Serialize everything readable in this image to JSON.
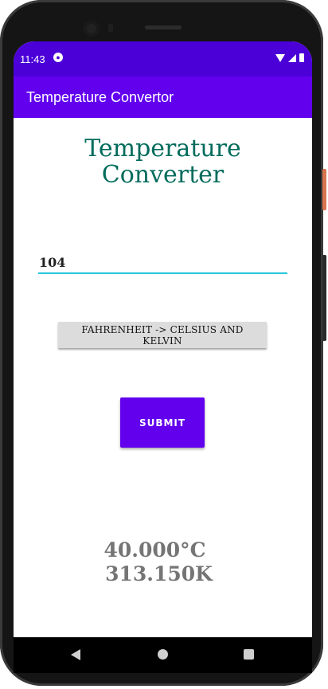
{
  "status_bar": {
    "time": "11:43",
    "app_icon": "notification-app-icon"
  },
  "app_bar": {
    "title": "Temperature Convertor"
  },
  "main": {
    "heading_line1": "Temperature",
    "heading_line2": "Converter",
    "input_value": "104",
    "mode_button_label": "FAHRENHEIT -> CELSIUS AND KELVIN",
    "submit_label": "SUBMIT",
    "result_celsius": "40.000°C",
    "result_kelvin": "313.150K"
  },
  "colors": {
    "status_bar": "#4b00d8",
    "app_bar": "#6200ee",
    "heading": "#006b5c",
    "input_underline": "#26c6da",
    "result_text": "#757575"
  }
}
